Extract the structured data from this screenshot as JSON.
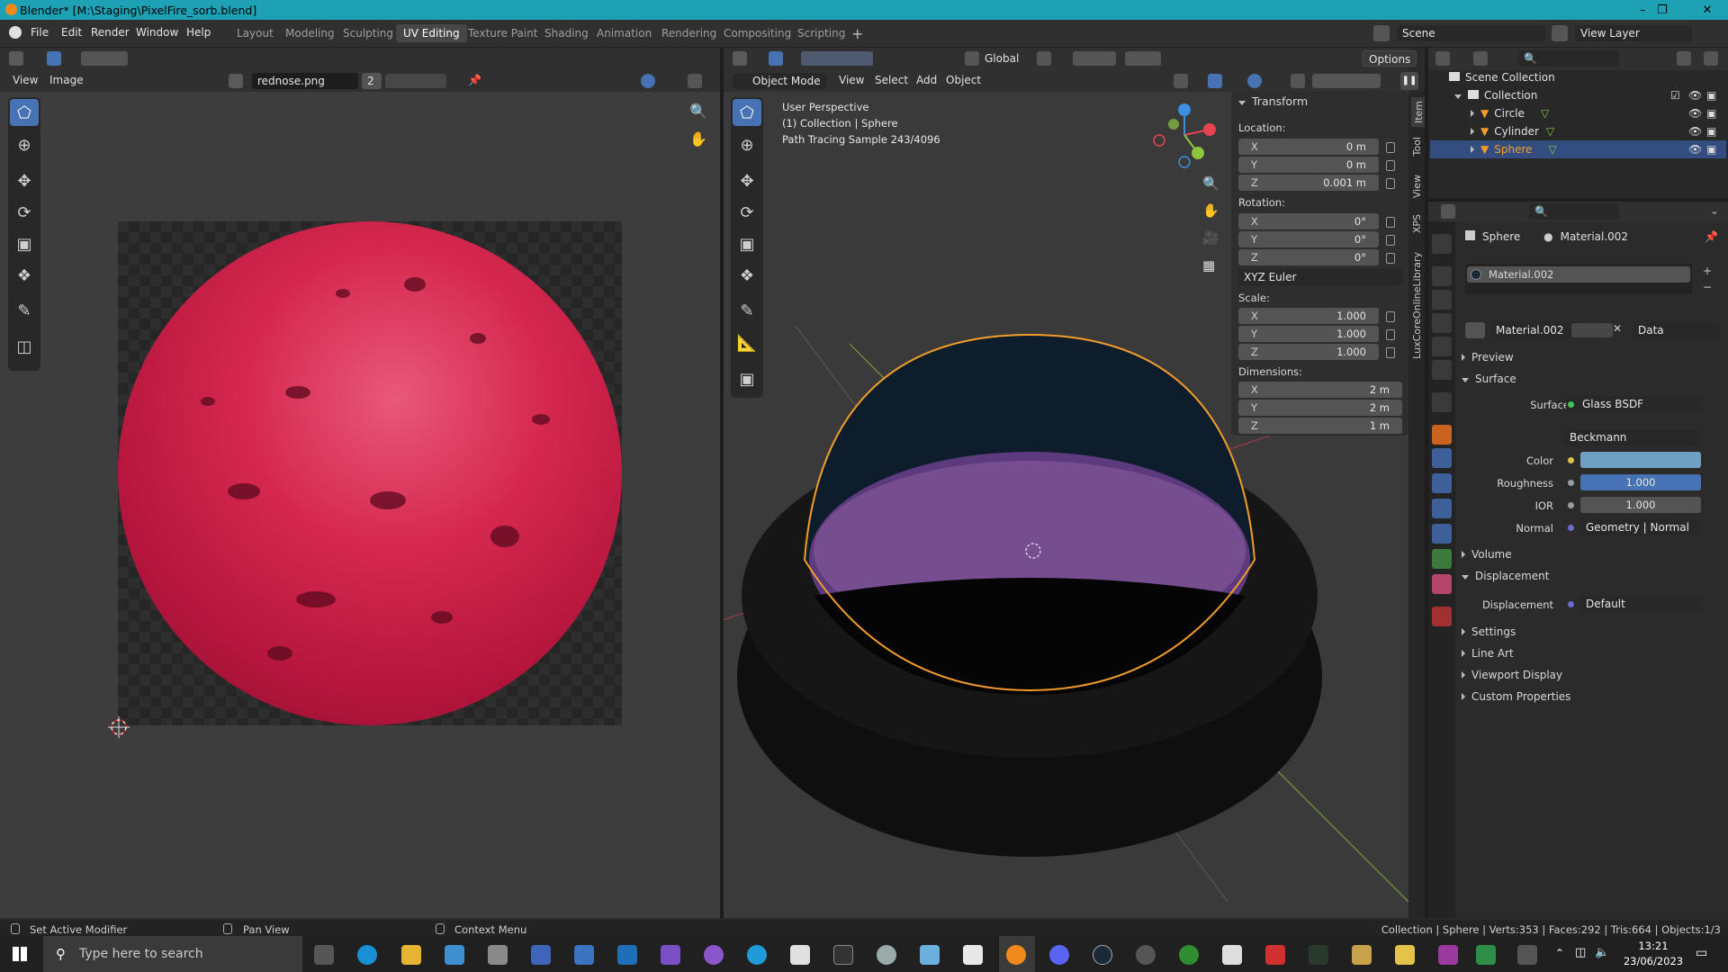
{
  "window": {
    "title": "Blender* [M:\\Staging\\PixelFire_sorb.blend]"
  },
  "menu": [
    "File",
    "Edit",
    "Render",
    "Window",
    "Help"
  ],
  "workspaces": [
    "Layout",
    "Modeling",
    "Sculpting",
    "UV Editing",
    "Texture Paint",
    "Shading",
    "Animation",
    "Rendering",
    "Compositing",
    "Scripting"
  ],
  "active_workspace": "UV Editing",
  "scene": {
    "name": "Scene",
    "view_layer": "View Layer"
  },
  "uv_editor": {
    "menus": [
      "View",
      "Image"
    ],
    "image_name": "rednose.png",
    "users": "2"
  },
  "viewport": {
    "mode": "Object Mode",
    "menus": [
      "View",
      "Select",
      "Add",
      "Object"
    ],
    "orientation": "Global",
    "options": "Options",
    "overlay_lines": [
      "User Perspective",
      "(1) Collection | Sphere",
      "Path Tracing Sample 243/4096"
    ]
  },
  "n_panel": {
    "tabs": [
      "Item",
      "Tool",
      "View",
      "XPS",
      "LuxCoreOnlineLibrary"
    ],
    "title": "Transform",
    "location_label": "Location:",
    "location": [
      {
        "axis": "X",
        "value": "0 m"
      },
      {
        "axis": "Y",
        "value": "0 m"
      },
      {
        "axis": "Z",
        "value": "0.001 m"
      }
    ],
    "rotation_label": "Rotation:",
    "rotation": [
      {
        "axis": "X",
        "value": "0°"
      },
      {
        "axis": "Y",
        "value": "0°"
      },
      {
        "axis": "Z",
        "value": "0°"
      }
    ],
    "rotation_mode": "XYZ Euler",
    "scale_label": "Scale:",
    "scale": [
      {
        "axis": "X",
        "value": "1.000"
      },
      {
        "axis": "Y",
        "value": "1.000"
      },
      {
        "axis": "Z",
        "value": "1.000"
      }
    ],
    "dimensions_label": "Dimensions:",
    "dimensions": [
      {
        "axis": "X",
        "value": "2 m"
      },
      {
        "axis": "Y",
        "value": "2 m"
      },
      {
        "axis": "Z",
        "value": "1 m"
      }
    ]
  },
  "outliner": {
    "root": "Scene Collection",
    "collection": "Collection",
    "objects": [
      "Circle",
      "Cylinder",
      "Sphere"
    ],
    "selected": "Sphere"
  },
  "properties": {
    "breadcrumb_object": "Sphere",
    "breadcrumb_material": "Material.002",
    "slot": "Material.002",
    "material_name": "Material.002",
    "link": "Data",
    "sections": {
      "preview": "Preview",
      "surface": "Surface",
      "volume": "Volume",
      "displacement": "Displacement",
      "settings": "Settings",
      "line_art": "Line Art",
      "viewport_display": "Viewport Display",
      "custom_properties": "Custom Properties"
    },
    "surface_label": "Surface",
    "surface_value": "Glass BSDF",
    "distribution": "Beckmann",
    "color_label": "Color",
    "color_value": "#6f9fc3",
    "roughness_label": "Roughness",
    "roughness_value": "1.000",
    "ior_label": "IOR",
    "ior_value": "1.000",
    "normal_label": "Normal",
    "normal_value": "Geometry | Normal",
    "displacement_label": "Displacement",
    "displacement_value": "Default"
  },
  "context_bar": {
    "left": "Set Active Modifier",
    "middle": "Pan View",
    "right": "Context Menu"
  },
  "status": "Collection | Sphere | Verts:353 | Faces:292 | Tris:664 | Objects:1/3",
  "taskbar": {
    "search_placeholder": "Type here to search",
    "time": "13:21",
    "date": "23/06/2023"
  },
  "colors": {
    "accent": "#4772b3",
    "title_bar": "#1ea0b5",
    "selection_outline": "#f39c2a",
    "axis_x": "#e64550",
    "axis_y": "#8cc63f",
    "axis_z": "#3b8fe0"
  }
}
